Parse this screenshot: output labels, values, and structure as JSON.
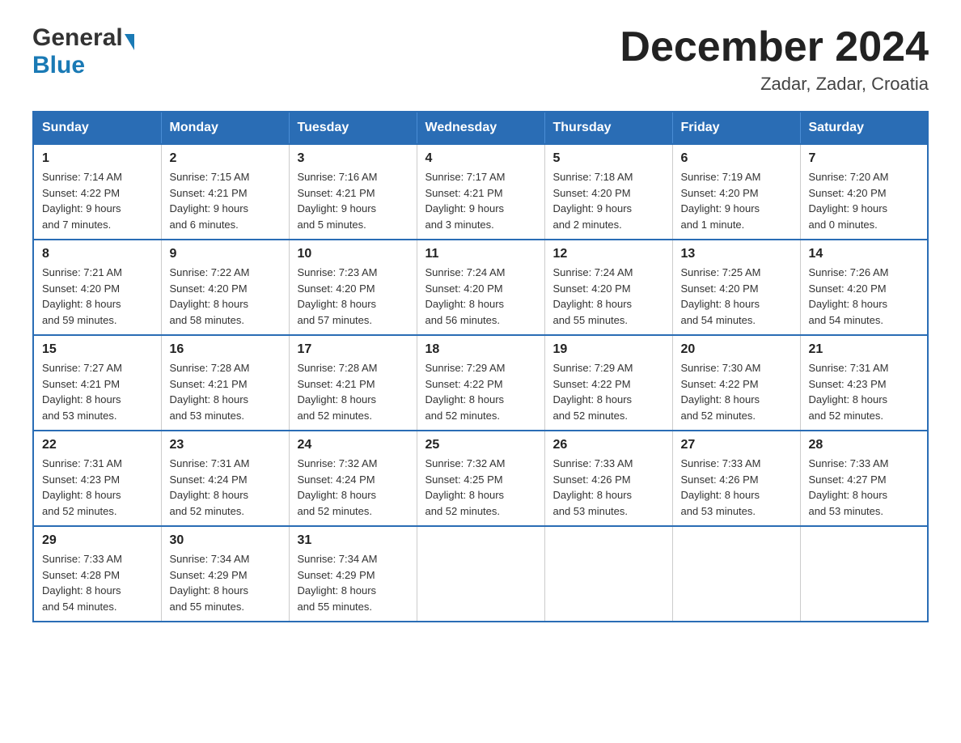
{
  "header": {
    "logo_general": "General",
    "logo_blue": "Blue",
    "month_title": "December 2024",
    "location": "Zadar, Zadar, Croatia"
  },
  "days_of_week": [
    "Sunday",
    "Monday",
    "Tuesday",
    "Wednesday",
    "Thursday",
    "Friday",
    "Saturday"
  ],
  "weeks": [
    [
      {
        "day": "1",
        "sunrise": "7:14 AM",
        "sunset": "4:22 PM",
        "daylight": "9 hours and 7 minutes."
      },
      {
        "day": "2",
        "sunrise": "7:15 AM",
        "sunset": "4:21 PM",
        "daylight": "9 hours and 6 minutes."
      },
      {
        "day": "3",
        "sunrise": "7:16 AM",
        "sunset": "4:21 PM",
        "daylight": "9 hours and 5 minutes."
      },
      {
        "day": "4",
        "sunrise": "7:17 AM",
        "sunset": "4:21 PM",
        "daylight": "9 hours and 3 minutes."
      },
      {
        "day": "5",
        "sunrise": "7:18 AM",
        "sunset": "4:20 PM",
        "daylight": "9 hours and 2 minutes."
      },
      {
        "day": "6",
        "sunrise": "7:19 AM",
        "sunset": "4:20 PM",
        "daylight": "9 hours and 1 minute."
      },
      {
        "day": "7",
        "sunrise": "7:20 AM",
        "sunset": "4:20 PM",
        "daylight": "9 hours and 0 minutes."
      }
    ],
    [
      {
        "day": "8",
        "sunrise": "7:21 AM",
        "sunset": "4:20 PM",
        "daylight": "8 hours and 59 minutes."
      },
      {
        "day": "9",
        "sunrise": "7:22 AM",
        "sunset": "4:20 PM",
        "daylight": "8 hours and 58 minutes."
      },
      {
        "day": "10",
        "sunrise": "7:23 AM",
        "sunset": "4:20 PM",
        "daylight": "8 hours and 57 minutes."
      },
      {
        "day": "11",
        "sunrise": "7:24 AM",
        "sunset": "4:20 PM",
        "daylight": "8 hours and 56 minutes."
      },
      {
        "day": "12",
        "sunrise": "7:24 AM",
        "sunset": "4:20 PM",
        "daylight": "8 hours and 55 minutes."
      },
      {
        "day": "13",
        "sunrise": "7:25 AM",
        "sunset": "4:20 PM",
        "daylight": "8 hours and 54 minutes."
      },
      {
        "day": "14",
        "sunrise": "7:26 AM",
        "sunset": "4:20 PM",
        "daylight": "8 hours and 54 minutes."
      }
    ],
    [
      {
        "day": "15",
        "sunrise": "7:27 AM",
        "sunset": "4:21 PM",
        "daylight": "8 hours and 53 minutes."
      },
      {
        "day": "16",
        "sunrise": "7:28 AM",
        "sunset": "4:21 PM",
        "daylight": "8 hours and 53 minutes."
      },
      {
        "day": "17",
        "sunrise": "7:28 AM",
        "sunset": "4:21 PM",
        "daylight": "8 hours and 52 minutes."
      },
      {
        "day": "18",
        "sunrise": "7:29 AM",
        "sunset": "4:22 PM",
        "daylight": "8 hours and 52 minutes."
      },
      {
        "day": "19",
        "sunrise": "7:29 AM",
        "sunset": "4:22 PM",
        "daylight": "8 hours and 52 minutes."
      },
      {
        "day": "20",
        "sunrise": "7:30 AM",
        "sunset": "4:22 PM",
        "daylight": "8 hours and 52 minutes."
      },
      {
        "day": "21",
        "sunrise": "7:31 AM",
        "sunset": "4:23 PM",
        "daylight": "8 hours and 52 minutes."
      }
    ],
    [
      {
        "day": "22",
        "sunrise": "7:31 AM",
        "sunset": "4:23 PM",
        "daylight": "8 hours and 52 minutes."
      },
      {
        "day": "23",
        "sunrise": "7:31 AM",
        "sunset": "4:24 PM",
        "daylight": "8 hours and 52 minutes."
      },
      {
        "day": "24",
        "sunrise": "7:32 AM",
        "sunset": "4:24 PM",
        "daylight": "8 hours and 52 minutes."
      },
      {
        "day": "25",
        "sunrise": "7:32 AM",
        "sunset": "4:25 PM",
        "daylight": "8 hours and 52 minutes."
      },
      {
        "day": "26",
        "sunrise": "7:33 AM",
        "sunset": "4:26 PM",
        "daylight": "8 hours and 53 minutes."
      },
      {
        "day": "27",
        "sunrise": "7:33 AM",
        "sunset": "4:26 PM",
        "daylight": "8 hours and 53 minutes."
      },
      {
        "day": "28",
        "sunrise": "7:33 AM",
        "sunset": "4:27 PM",
        "daylight": "8 hours and 53 minutes."
      }
    ],
    [
      {
        "day": "29",
        "sunrise": "7:33 AM",
        "sunset": "4:28 PM",
        "daylight": "8 hours and 54 minutes."
      },
      {
        "day": "30",
        "sunrise": "7:34 AM",
        "sunset": "4:29 PM",
        "daylight": "8 hours and 55 minutes."
      },
      {
        "day": "31",
        "sunrise": "7:34 AM",
        "sunset": "4:29 PM",
        "daylight": "8 hours and 55 minutes."
      },
      null,
      null,
      null,
      null
    ]
  ]
}
